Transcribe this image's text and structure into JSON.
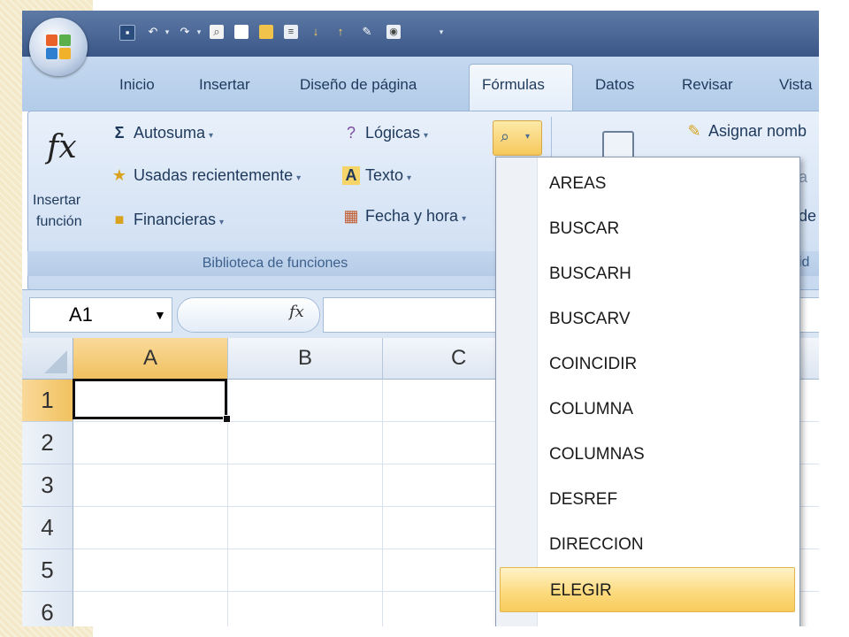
{
  "window": {
    "tabs": [
      {
        "label": "Inicio"
      },
      {
        "label": "Insertar"
      },
      {
        "label": "Diseño de página"
      },
      {
        "label": "Fórmulas",
        "selected": true
      },
      {
        "label": "Datos"
      },
      {
        "label": "Revisar"
      },
      {
        "label": "Vista"
      }
    ]
  },
  "ribbon": {
    "insert_function": {
      "line1": "Insertar",
      "line2": "función",
      "icon": "fx-icon",
      "symbol": "fx"
    },
    "autosum": {
      "label": "Autosuma",
      "icon": "sigma-icon",
      "symbol": "Σ"
    },
    "recent": {
      "label": "Usadas recientemente",
      "icon": "recent-functions-icon"
    },
    "financial": {
      "label": "Financieras",
      "icon": "financial-functions-icon"
    },
    "logical": {
      "label": "Lógicas",
      "icon": "logical-functions-icon"
    },
    "text": {
      "label": "Texto",
      "icon": "text-functions-icon"
    },
    "datetime": {
      "label": "Fecha y hora",
      "icon": "datetime-functions-icon"
    },
    "lookup": {
      "icon": "lookup-reference-icon"
    },
    "group_label": "Biblioteca de funciones",
    "define_name": {
      "label": "Asignar nomb",
      "icon": "define-name-icon"
    },
    "partial_right": {
      "line2": "a",
      "line3": "de",
      "group_fragment": "id"
    }
  },
  "formula_bar": {
    "name_box": "A1",
    "fx_label": "fx",
    "formula": ""
  },
  "sheet": {
    "columns": [
      "A",
      "B",
      "C"
    ],
    "rows": [
      "1",
      "2",
      "3",
      "4",
      "5",
      "6"
    ],
    "active_cell": "A1"
  },
  "dropdown": {
    "items": [
      "AREAS",
      "BUSCAR",
      "BUSCARH",
      "BUSCARV",
      "COINCIDIR",
      "COLUMNA",
      "COLUMNAS",
      "DESREF",
      "DIRECCION",
      "ELEGIR"
    ],
    "highlighted": "ELEGIR"
  },
  "colors": {
    "accent": "#f8cb5d",
    "ribbon": "#d4e2f4",
    "title_bar": "#3a5687"
  }
}
